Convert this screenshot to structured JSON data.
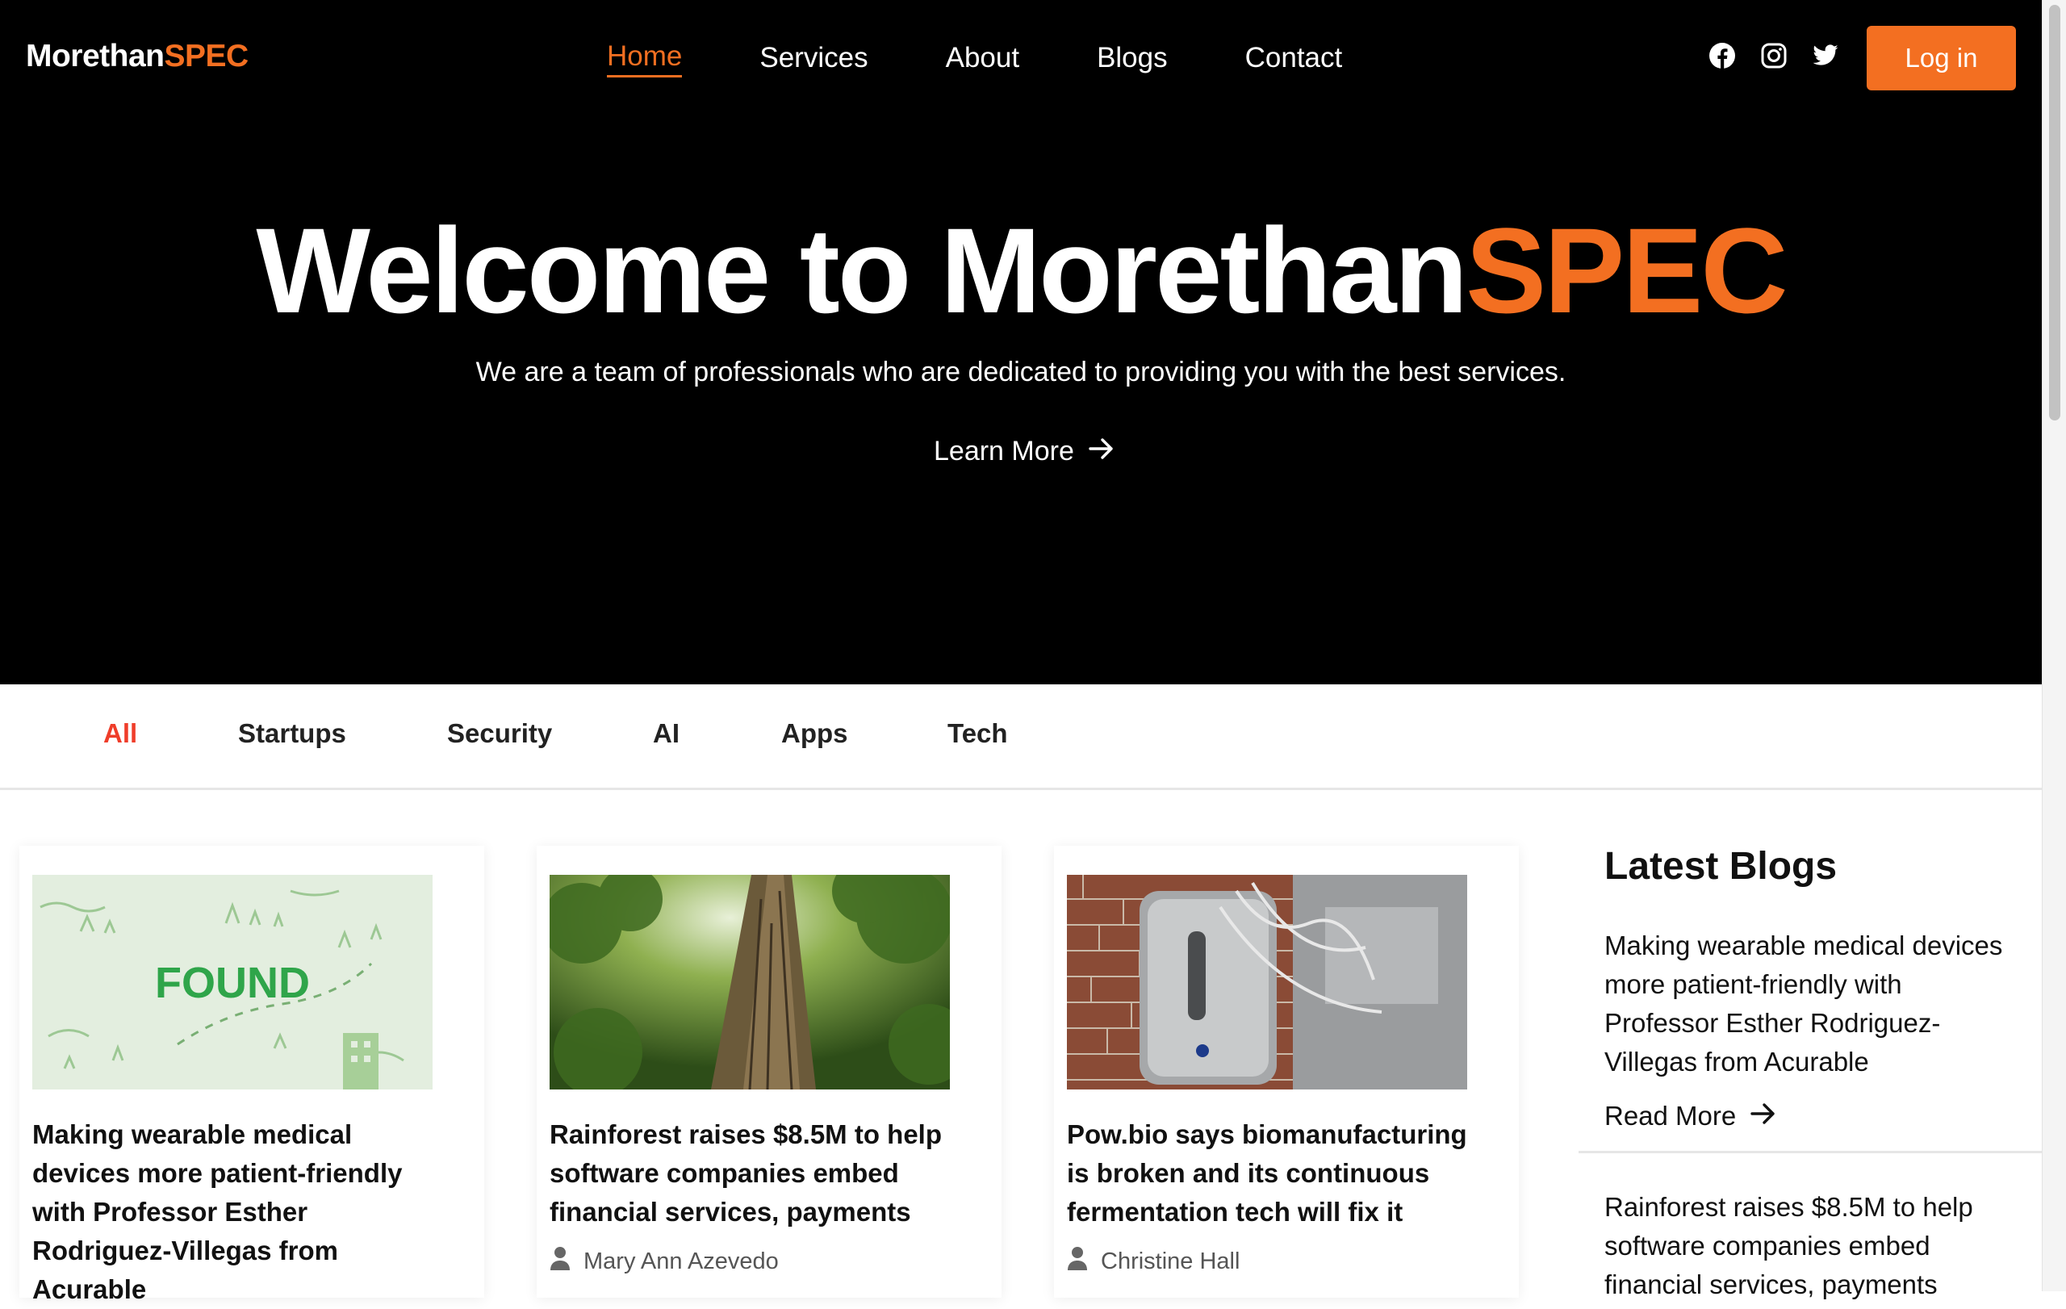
{
  "header": {
    "logo_main": "Morethan",
    "logo_accent": "SPEC",
    "nav": [
      "Home",
      "Services",
      "About",
      "Blogs",
      "Contact"
    ],
    "active_nav": "Home",
    "social_icons": [
      "facebook-icon",
      "instagram-icon",
      "twitter-icon"
    ],
    "login_label": "Log in"
  },
  "hero": {
    "title_main": "Welcome to Morethan",
    "title_accent": "SPEC",
    "subtitle": "We are a team of professionals who are dedicated to providing you with the best services.",
    "cta_label": "Learn More"
  },
  "categories": {
    "items": [
      "All",
      "Startups",
      "Security",
      "AI",
      "Apps",
      "Tech"
    ],
    "active": "All"
  },
  "posts": [
    {
      "image": "found-illustration",
      "image_text": "FOUND",
      "title": "Making wearable medical devices more patient-friendly with Professor Esther Rodriguez-Villegas from Acurable",
      "author": ""
    },
    {
      "image": "rainforest-photo",
      "title": "Rainforest raises $8.5M to help software companies embed financial services, payments",
      "author": "Mary Ann Azevedo"
    },
    {
      "image": "bioreactor-photo",
      "title": "Pow.bio says biomanufacturing is broken and its continuous fermentation tech will fix it",
      "author": "Christine Hall"
    }
  ],
  "sidebar": {
    "title": "Latest Blogs",
    "items": [
      {
        "title": "Making wearable medical devices more patient-friendly with Professor Esther Rodriguez-Villegas from Acurable",
        "read_more": "Read More"
      },
      {
        "title": "Rainforest raises $8.5M to help software companies embed financial services, payments"
      }
    ]
  },
  "colors": {
    "accent": "#f36f21",
    "active_tab": "#ef3d2a",
    "hero_bg": "#000000"
  }
}
